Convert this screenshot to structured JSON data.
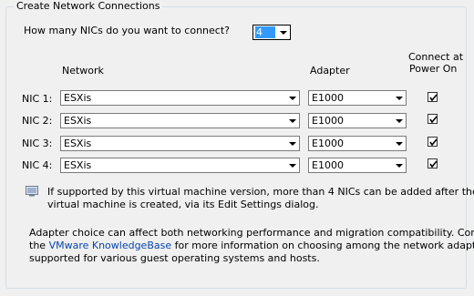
{
  "group_title": "Create Network Connections",
  "nic_count_question": "How many NICs do you want to connect?",
  "nic_count_value": "4",
  "headers": {
    "network": "Network",
    "adapter": "Adapter",
    "connect_line1": "Connect at",
    "connect_line2": "Power On"
  },
  "nics": [
    {
      "label": "NIC 1:",
      "network": "ESXis",
      "adapter": "E1000",
      "connected": true
    },
    {
      "label": "NIC 2:",
      "network": "ESXis",
      "adapter": "E1000",
      "connected": true
    },
    {
      "label": "NIC 3:",
      "network": "ESXis",
      "adapter": "E1000",
      "connected": true
    },
    {
      "label": "NIC 4:",
      "network": "ESXis",
      "adapter": "E1000",
      "connected": true
    }
  ],
  "info_note": {
    "icon": "info-icon",
    "line1": "If supported by this virtual machine version, more than 4 NICs can be added after the",
    "line2": "virtual machine is created, via its Edit Settings dialog."
  },
  "adapter_note": {
    "line1": "Adapter choice can affect both networking performance and migration compatibility. Consult",
    "line2_pre": "the ",
    "link": "VMware KnowledgeBase",
    "line2_post": " for more information on choosing among the network adapters",
    "line3": "supported for various guest operating systems and hosts."
  },
  "colors": {
    "selection": "#3399ff",
    "link": "#0645ad",
    "background": "#f0f0f0"
  }
}
